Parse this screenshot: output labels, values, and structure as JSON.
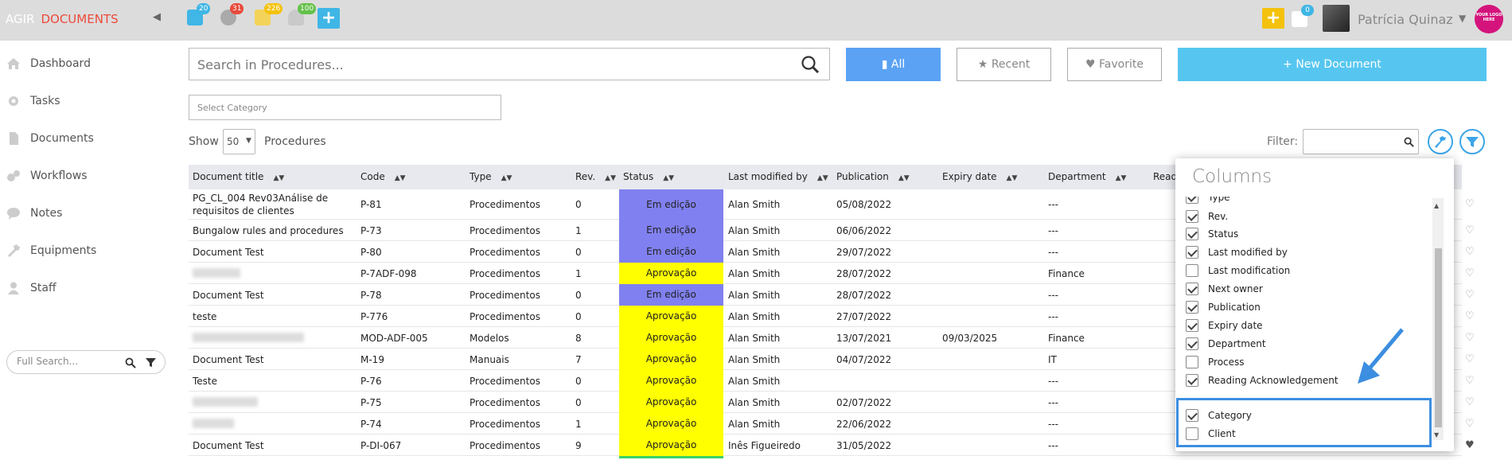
{
  "topbar": {
    "brand_agir": "AGIR",
    "brand_docs": "DOCUMENTS",
    "badges": {
      "calendar": "20",
      "settings": "31",
      "tasks": "226",
      "notifications": "100",
      "messages": "0"
    },
    "user_name": "Patrícia Quinaz",
    "logo_text": "YOUR LOGO HERE",
    "colors": {
      "calendar": "#3fb6e5",
      "settings": "#e84a3c",
      "tasks": "#f4c20d",
      "notifications": "#64c14a",
      "add": "#3fb6e5",
      "quick_add": "#f4c20d"
    }
  },
  "sidebar": {
    "items": [
      {
        "label": "Dashboard",
        "icon": "home-icon"
      },
      {
        "label": "Tasks",
        "icon": "gear-icon"
      },
      {
        "label": "Documents",
        "icon": "document-icon"
      },
      {
        "label": "Workflows",
        "icon": "workflow-icon"
      },
      {
        "label": "Notes",
        "icon": "chat-icon"
      },
      {
        "label": "Equipments",
        "icon": "wrench-icon"
      },
      {
        "label": "Staff",
        "icon": "user-icon"
      }
    ],
    "full_search_placeholder": "Full Search..."
  },
  "main": {
    "search_placeholder": "Search in Procedures...",
    "buttons": {
      "all": "All",
      "recent": "Recent",
      "favorite": "Favorite",
      "new_document": "New Document"
    },
    "select_category_placeholder": "Select Category",
    "show_label": "Show",
    "show_value": "50",
    "procedures_label": "Procedures",
    "filter_label": "Filter:"
  },
  "table": {
    "columns": [
      "Document title",
      "Code",
      "Type",
      "Rev.",
      "Status",
      "Last modified by",
      "Publication",
      "Expiry date",
      "Department",
      "Readi"
    ],
    "rows": [
      {
        "title": "PG_CL_004 Rev03Análise de requisitos de clientes",
        "code": "P-81",
        "type": "Procedimentos",
        "rev": "0",
        "status": "Em edição",
        "modified_by": "Alan Smith",
        "publication": "05/08/2022",
        "expiry": "",
        "department": "---"
      },
      {
        "title": "Bungalow rules and procedures",
        "code": "P-73",
        "type": "Procedimentos",
        "rev": "1",
        "status": "Em edição",
        "modified_by": "Alan Smith",
        "publication": "06/06/2022",
        "expiry": "",
        "department": "---"
      },
      {
        "title": "Document Test",
        "code": "P-80",
        "type": "Procedimentos",
        "rev": "0",
        "status": "Em edição",
        "modified_by": "Alan Smith",
        "publication": "29/07/2022",
        "expiry": "",
        "department": "---"
      },
      {
        "title": "",
        "code": "P-7ADF-098",
        "type": "Procedimentos",
        "rev": "1",
        "status": "Aprovação",
        "modified_by": "Alan Smith",
        "publication": "28/07/2022",
        "expiry": "",
        "department": "Finance"
      },
      {
        "title": "Document Test",
        "code": "P-78",
        "type": "Procedimentos",
        "rev": "0",
        "status": "Em edição",
        "modified_by": "Alan Smith",
        "publication": "28/07/2022",
        "expiry": "",
        "department": "---"
      },
      {
        "title": "teste",
        "code": "P-776",
        "type": "Procedimentos",
        "rev": "0",
        "status": "Aprovação",
        "modified_by": "Alan Smith",
        "publication": "27/07/2022",
        "expiry": "",
        "department": "---"
      },
      {
        "title": "",
        "code": "MOD-ADF-005",
        "type": "Modelos",
        "rev": "8",
        "status": "Aprovação",
        "modified_by": "Alan Smith",
        "publication": "13/07/2021",
        "expiry": "09/03/2025",
        "department": "Finance"
      },
      {
        "title": "Document Test",
        "code": "M-19",
        "type": "Manuais",
        "rev": "7",
        "status": "Aprovação",
        "modified_by": "Alan Smith",
        "publication": "04/07/2022",
        "expiry": "",
        "department": "IT"
      },
      {
        "title": "Teste",
        "code": "P-76",
        "type": "Procedimentos",
        "rev": "0",
        "status": "Aprovação",
        "modified_by": "Alan Smith",
        "publication": "",
        "expiry": "",
        "department": "---"
      },
      {
        "title": "",
        "code": "P-75",
        "type": "Procedimentos",
        "rev": "0",
        "status": "Aprovação",
        "modified_by": "Alan Smith",
        "publication": "02/07/2022",
        "expiry": "",
        "department": "---"
      },
      {
        "title": "",
        "code": "P-74",
        "type": "Procedimentos",
        "rev": "1",
        "status": "Aprovação",
        "modified_by": "Alan Smith",
        "publication": "22/06/2022",
        "expiry": "",
        "department": "---"
      },
      {
        "title": "Document Test",
        "code": "P-DI-067",
        "type": "Procedimentos",
        "rev": "9",
        "status": "Aprovação",
        "modified_by": "Inês Figueiredo",
        "publication": "31/05/2022",
        "expiry": "",
        "department": "---"
      }
    ],
    "status_colors": {
      "Em edição": "#8080f0",
      "Aprovação": "#ffff00"
    }
  },
  "columns_popup": {
    "title": "Columns",
    "items": [
      {
        "label": "Type",
        "checked": true
      },
      {
        "label": "Rev.",
        "checked": true
      },
      {
        "label": "Status",
        "checked": true
      },
      {
        "label": "Last modified by",
        "checked": true
      },
      {
        "label": "Last modification",
        "checked": false
      },
      {
        "label": "Next owner",
        "checked": true
      },
      {
        "label": "Publication",
        "checked": true
      },
      {
        "label": "Expiry date",
        "checked": true
      },
      {
        "label": "Department",
        "checked": true
      },
      {
        "label": "Process",
        "checked": false
      },
      {
        "label": "Reading Acknowledgement",
        "checked": true
      },
      {
        "label": "Category",
        "checked": true
      },
      {
        "label": "Client",
        "checked": false
      }
    ]
  }
}
